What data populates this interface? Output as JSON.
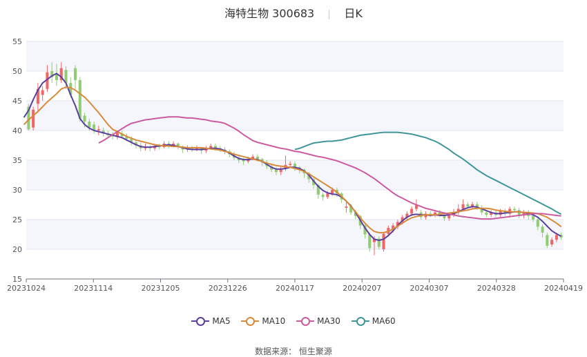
{
  "title": {
    "name": "海特生物 300683",
    "period": "日K"
  },
  "source": {
    "label": "数据来源：",
    "value": "恒生聚源"
  },
  "colors": {
    "up": "#ee6666",
    "down": "#91cc75",
    "grid": "#e0e6f1",
    "band": "#f4f6fb"
  },
  "chart_data": {
    "type": "candlestick",
    "xlabels": [
      "20231024",
      "20231114",
      "20231205",
      "20231226",
      "20240117",
      "20240207",
      "20240307",
      "20240328",
      "20240419"
    ],
    "ylim": [
      15,
      55
    ],
    "yticks": [
      15,
      20,
      25,
      30,
      35,
      40,
      45,
      50,
      55
    ],
    "ohlc": [
      [
        44.0,
        40.2,
        44.5,
        40.0
      ],
      [
        40.5,
        43.5,
        44.0,
        40.0
      ],
      [
        44.5,
        47.0,
        48.0,
        43.0
      ],
      [
        46.0,
        46.8,
        47.5,
        45.0
      ],
      [
        47.0,
        49.8,
        51.0,
        46.5
      ],
      [
        50.0,
        49.0,
        51.5,
        48.0
      ],
      [
        49.5,
        48.5,
        51.2,
        47.5
      ],
      [
        48.5,
        50.5,
        51.5,
        48.0
      ],
      [
        50.2,
        48.0,
        50.8,
        47.0
      ],
      [
        48.0,
        46.0,
        49.0,
        45.5
      ],
      [
        50.5,
        48.5,
        51.0,
        47.0
      ],
      [
        48.5,
        42.0,
        49.0,
        41.5
      ],
      [
        42.5,
        41.5,
        43.0,
        40.5
      ],
      [
        41.5,
        40.5,
        42.0,
        40.0
      ],
      [
        41.0,
        40.0,
        41.5,
        39.5
      ],
      [
        40.0,
        40.2,
        40.8,
        39.2
      ],
      [
        40.0,
        39.5,
        40.5,
        39.0
      ],
      [
        39.5,
        39.2,
        40.0,
        38.8
      ],
      [
        39.4,
        39.0,
        39.8,
        38.5
      ],
      [
        39.0,
        39.6,
        40.0,
        38.5
      ],
      [
        39.5,
        39.0,
        40.0,
        38.6
      ],
      [
        39.0,
        38.6,
        39.5,
        38.2
      ],
      [
        38.6,
        38.0,
        39.0,
        37.5
      ],
      [
        38.0,
        37.5,
        38.5,
        37.0
      ],
      [
        37.5,
        37.0,
        38.0,
        36.5
      ],
      [
        37.0,
        37.2,
        37.8,
        36.6
      ],
      [
        37.2,
        37.0,
        37.5,
        36.5
      ],
      [
        37.0,
        37.4,
        37.8,
        36.6
      ],
      [
        37.4,
        37.2,
        37.8,
        36.8
      ],
      [
        37.2,
        37.8,
        38.2,
        37.0
      ],
      [
        37.8,
        37.5,
        38.2,
        37.0
      ],
      [
        37.5,
        37.8,
        38.2,
        37.2
      ],
      [
        37.8,
        37.2,
        38.0,
        36.8
      ],
      [
        37.2,
        36.8,
        37.5,
        36.2
      ],
      [
        36.8,
        37.0,
        37.5,
        36.4
      ],
      [
        37.0,
        36.8,
        37.4,
        36.4
      ],
      [
        36.8,
        37.0,
        37.5,
        36.5
      ],
      [
        37.0,
        36.6,
        37.2,
        36.0
      ],
      [
        36.6,
        37.0,
        37.4,
        36.2
      ],
      [
        37.0,
        37.4,
        37.8,
        36.8
      ],
      [
        37.4,
        37.0,
        37.8,
        36.6
      ],
      [
        37.0,
        36.8,
        37.4,
        36.4
      ],
      [
        36.8,
        36.5,
        37.2,
        36.0
      ],
      [
        36.5,
        36.0,
        36.8,
        35.5
      ],
      [
        36.0,
        35.4,
        36.4,
        35.0
      ],
      [
        35.4,
        35.0,
        35.8,
        34.5
      ],
      [
        35.0,
        34.8,
        35.4,
        34.2
      ],
      [
        34.8,
        35.2,
        35.6,
        34.5
      ],
      [
        35.2,
        35.6,
        36.0,
        35.0
      ],
      [
        35.6,
        35.2,
        36.0,
        34.8
      ],
      [
        35.2,
        34.6,
        35.4,
        34.0
      ],
      [
        34.6,
        34.0,
        35.0,
        33.5
      ],
      [
        34.0,
        33.4,
        34.4,
        33.0
      ],
      [
        33.4,
        33.0,
        33.8,
        32.5
      ],
      [
        33.0,
        33.6,
        34.0,
        32.5
      ],
      [
        33.6,
        34.2,
        35.8,
        33.2
      ],
      [
        34.2,
        34.4,
        34.8,
        33.8
      ],
      [
        34.4,
        33.8,
        34.8,
        33.2
      ],
      [
        33.8,
        33.4,
        34.0,
        32.8
      ],
      [
        33.4,
        32.8,
        33.6,
        32.0
      ],
      [
        32.8,
        31.8,
        33.0,
        31.2
      ],
      [
        31.8,
        30.8,
        32.0,
        30.2
      ],
      [
        30.8,
        29.2,
        31.0,
        28.5
      ],
      [
        29.2,
        28.8,
        29.6,
        28.2
      ],
      [
        28.8,
        29.4,
        29.8,
        28.5
      ],
      [
        29.4,
        30.0,
        30.4,
        29.0
      ],
      [
        30.0,
        29.4,
        30.4,
        28.8
      ],
      [
        29.4,
        28.4,
        29.6,
        27.8
      ],
      [
        27.0,
        27.2,
        28.0,
        26.2
      ],
      [
        27.2,
        26.2,
        27.6,
        25.8
      ],
      [
        26.2,
        25.6,
        26.6,
        25.0
      ],
      [
        25.6,
        24.0,
        25.8,
        23.4
      ],
      [
        24.0,
        22.5,
        24.2,
        21.8
      ],
      [
        22.5,
        20.2,
        22.8,
        19.6
      ],
      [
        21.2,
        21.8,
        22.2,
        19.0
      ],
      [
        21.8,
        20.4,
        22.2,
        20.0
      ],
      [
        20.0,
        22.6,
        22.8,
        19.6
      ],
      [
        22.6,
        23.6,
        24.0,
        22.2
      ],
      [
        23.2,
        24.0,
        24.4,
        22.8
      ],
      [
        23.8,
        24.6,
        25.0,
        23.4
      ],
      [
        24.6,
        25.4,
        25.8,
        24.2
      ],
      [
        25.4,
        26.0,
        26.4,
        25.0
      ],
      [
        26.0,
        26.8,
        27.2,
        25.6
      ],
      [
        26.8,
        27.4,
        28.4,
        26.4
      ],
      [
        26.2,
        25.4,
        26.6,
        25.0
      ],
      [
        25.4,
        26.0,
        26.4,
        25.0
      ],
      [
        26.0,
        25.8,
        26.4,
        25.4
      ],
      [
        25.8,
        26.2,
        26.6,
        25.4
      ],
      [
        26.2,
        25.8,
        26.6,
        25.4
      ],
      [
        25.8,
        25.2,
        26.2,
        24.8
      ],
      [
        25.2,
        25.8,
        26.2,
        24.8
      ],
      [
        25.8,
        26.2,
        26.8,
        25.4
      ],
      [
        26.2,
        26.8,
        27.6,
        25.8
      ],
      [
        26.8,
        27.6,
        28.4,
        26.4
      ],
      [
        27.6,
        27.2,
        28.0,
        26.8
      ],
      [
        27.2,
        27.6,
        28.0,
        26.8
      ],
      [
        27.6,
        27.0,
        28.0,
        26.6
      ],
      [
        27.0,
        26.2,
        27.4,
        25.8
      ],
      [
        26.2,
        25.8,
        26.6,
        25.4
      ],
      [
        25.8,
        26.2,
        26.6,
        25.4
      ],
      [
        26.2,
        25.8,
        26.6,
        25.4
      ],
      [
        25.8,
        26.4,
        26.8,
        25.4
      ],
      [
        26.4,
        26.0,
        26.8,
        25.6
      ],
      [
        26.0,
        26.8,
        27.2,
        25.6
      ],
      [
        26.8,
        26.6,
        27.2,
        26.2
      ],
      [
        26.6,
        25.8,
        27.0,
        25.2
      ],
      [
        25.8,
        26.2,
        26.6,
        25.2
      ],
      [
        26.2,
        25.6,
        26.6,
        25.0
      ],
      [
        25.6,
        25.0,
        26.0,
        24.6
      ],
      [
        25.0,
        23.8,
        25.4,
        23.2
      ],
      [
        23.8,
        22.8,
        24.2,
        22.0
      ],
      [
        22.4,
        20.6,
        22.8,
        20.2
      ],
      [
        20.8,
        21.6,
        22.0,
        20.4
      ],
      [
        21.6,
        22.4,
        22.8,
        21.2
      ],
      [
        22.4,
        22.0,
        22.8,
        21.6
      ]
    ],
    "series": [
      {
        "name": "MA5",
        "color": "#5a3f9f",
        "values": [
          42.2,
          43.4,
          45.2,
          46.8,
          48.0,
          48.6,
          49.2,
          49.6,
          49.0,
          48.0,
          46.0,
          44.2,
          42.0,
          41.0,
          40.4,
          40.0,
          39.8,
          39.6,
          39.4,
          39.2,
          39.0,
          38.8,
          38.4,
          38.0,
          37.6,
          37.3,
          37.2,
          37.2,
          37.3,
          37.4,
          37.5,
          37.6,
          37.5,
          37.3,
          37.1,
          36.9,
          36.8,
          36.8,
          36.8,
          36.9,
          37.0,
          37.0,
          36.9,
          36.6,
          36.2,
          35.7,
          35.3,
          35.1,
          35.1,
          35.2,
          35.1,
          34.8,
          34.3,
          33.8,
          33.5,
          33.5,
          33.6,
          33.8,
          33.8,
          33.6,
          33.2,
          32.5,
          31.5,
          30.6,
          29.9,
          29.5,
          29.3,
          29.2,
          28.8,
          28.1,
          27.3,
          26.2,
          24.9,
          23.6,
          22.5,
          21.7,
          21.5,
          21.7,
          22.3,
          23.1,
          24.0,
          24.8,
          25.4,
          25.8,
          25.9,
          25.8,
          25.8,
          25.7,
          25.8,
          25.7,
          25.7,
          25.8,
          26.0,
          26.3,
          26.7,
          27.0,
          27.2,
          27.1,
          26.8,
          26.5,
          26.2,
          26.0,
          26.0,
          26.1,
          26.2,
          26.3,
          26.3,
          26.2,
          26.0,
          25.8,
          25.4,
          24.7,
          23.9,
          23.1,
          22.6,
          22.2
        ]
      },
      {
        "name": "MA10",
        "color": "#d88a3a",
        "values": [
          41.0,
          41.8,
          42.5,
          43.2,
          44.0,
          44.8,
          45.5,
          46.2,
          47.0,
          47.3,
          47.2,
          46.8,
          46.2,
          45.6,
          44.8,
          43.9,
          43.0,
          42.0,
          41.0,
          40.2,
          39.8,
          39.4,
          39.0,
          38.7,
          38.4,
          38.2,
          38.0,
          37.8,
          37.6,
          37.5,
          37.4,
          37.4,
          37.3,
          37.3,
          37.2,
          37.1,
          37.1,
          37.1,
          37.1,
          37.0,
          36.9,
          36.8,
          36.7,
          36.5,
          36.3,
          36.0,
          35.8,
          35.6,
          35.4,
          35.2,
          35.0,
          34.8,
          34.5,
          34.3,
          34.1,
          34.0,
          33.9,
          33.8,
          33.6,
          33.4,
          33.1,
          32.7,
          32.2,
          31.7,
          31.2,
          30.7,
          30.2,
          29.6,
          28.9,
          28.1,
          27.2,
          26.3,
          25.3,
          24.4,
          23.6,
          23.0,
          22.8,
          22.8,
          23.0,
          23.4,
          23.9,
          24.4,
          24.9,
          25.3,
          25.5,
          25.7,
          25.8,
          25.8,
          25.8,
          25.9,
          26.0,
          26.1,
          26.2,
          26.3,
          26.5,
          26.6,
          26.8,
          26.9,
          26.9,
          26.9,
          26.8,
          26.6,
          26.5,
          26.4,
          26.3,
          26.3,
          26.3,
          26.2,
          26.2,
          26.1,
          26.0,
          25.7,
          25.4,
          24.9,
          24.4,
          23.8
        ]
      },
      {
        "name": "MA30",
        "color": "#cc5a9e",
        "values": [
          37.9,
          38.3,
          38.8,
          39.3,
          39.8,
          40.3,
          40.8,
          41.2,
          41.4,
          41.6,
          41.8,
          41.9,
          42.0,
          42.1,
          42.2,
          42.3,
          42.3,
          42.3,
          42.2,
          42.1,
          42.1,
          42.0,
          41.9,
          41.8,
          41.6,
          41.5,
          41.4,
          41.2,
          40.8,
          40.4,
          39.9,
          39.3,
          38.8,
          38.3,
          38.0,
          37.8,
          37.6,
          37.4,
          37.2,
          37.0,
          36.9,
          36.7,
          36.5,
          36.4,
          36.2,
          36.0,
          35.8,
          35.6,
          35.5,
          35.3,
          35.1,
          34.9,
          34.6,
          34.3,
          34.0,
          33.7,
          33.3,
          32.9,
          32.4,
          31.9,
          31.3,
          30.7,
          30.1,
          29.5,
          29.0,
          28.6,
          28.2,
          27.8,
          27.5,
          27.2,
          26.9,
          26.7,
          26.5,
          26.3,
          26.1,
          25.9,
          25.8,
          25.6,
          25.5,
          25.4,
          25.3,
          25.2,
          25.1,
          25.1,
          25.1,
          25.2,
          25.3,
          25.4,
          25.5,
          25.6,
          25.7,
          25.8,
          25.9,
          26.0,
          26.0,
          26.0,
          25.9,
          25.8,
          25.7,
          25.6
        ]
      },
      {
        "name": "MA60",
        "color": "#3f9597",
        "values": [
          36.8,
          37.0,
          37.3,
          37.6,
          37.9,
          38.0,
          38.1,
          38.2,
          38.2,
          38.3,
          38.4,
          38.6,
          38.8,
          39.0,
          39.2,
          39.3,
          39.4,
          39.5,
          39.6,
          39.7,
          39.7,
          39.7,
          39.7,
          39.6,
          39.5,
          39.4,
          39.2,
          39.0,
          38.8,
          38.5,
          38.2,
          37.8,
          37.3,
          36.8,
          36.2,
          35.7,
          35.2,
          34.6,
          34.0,
          33.4,
          32.9,
          32.4,
          32.0,
          31.6,
          31.2,
          30.8,
          30.4,
          30.0,
          29.6,
          29.2,
          28.8,
          28.4,
          28.0,
          27.6,
          27.2,
          26.8,
          26.3,
          25.9
        ]
      }
    ],
    "legend": [
      "MA5",
      "MA10",
      "MA30",
      "MA60"
    ]
  }
}
